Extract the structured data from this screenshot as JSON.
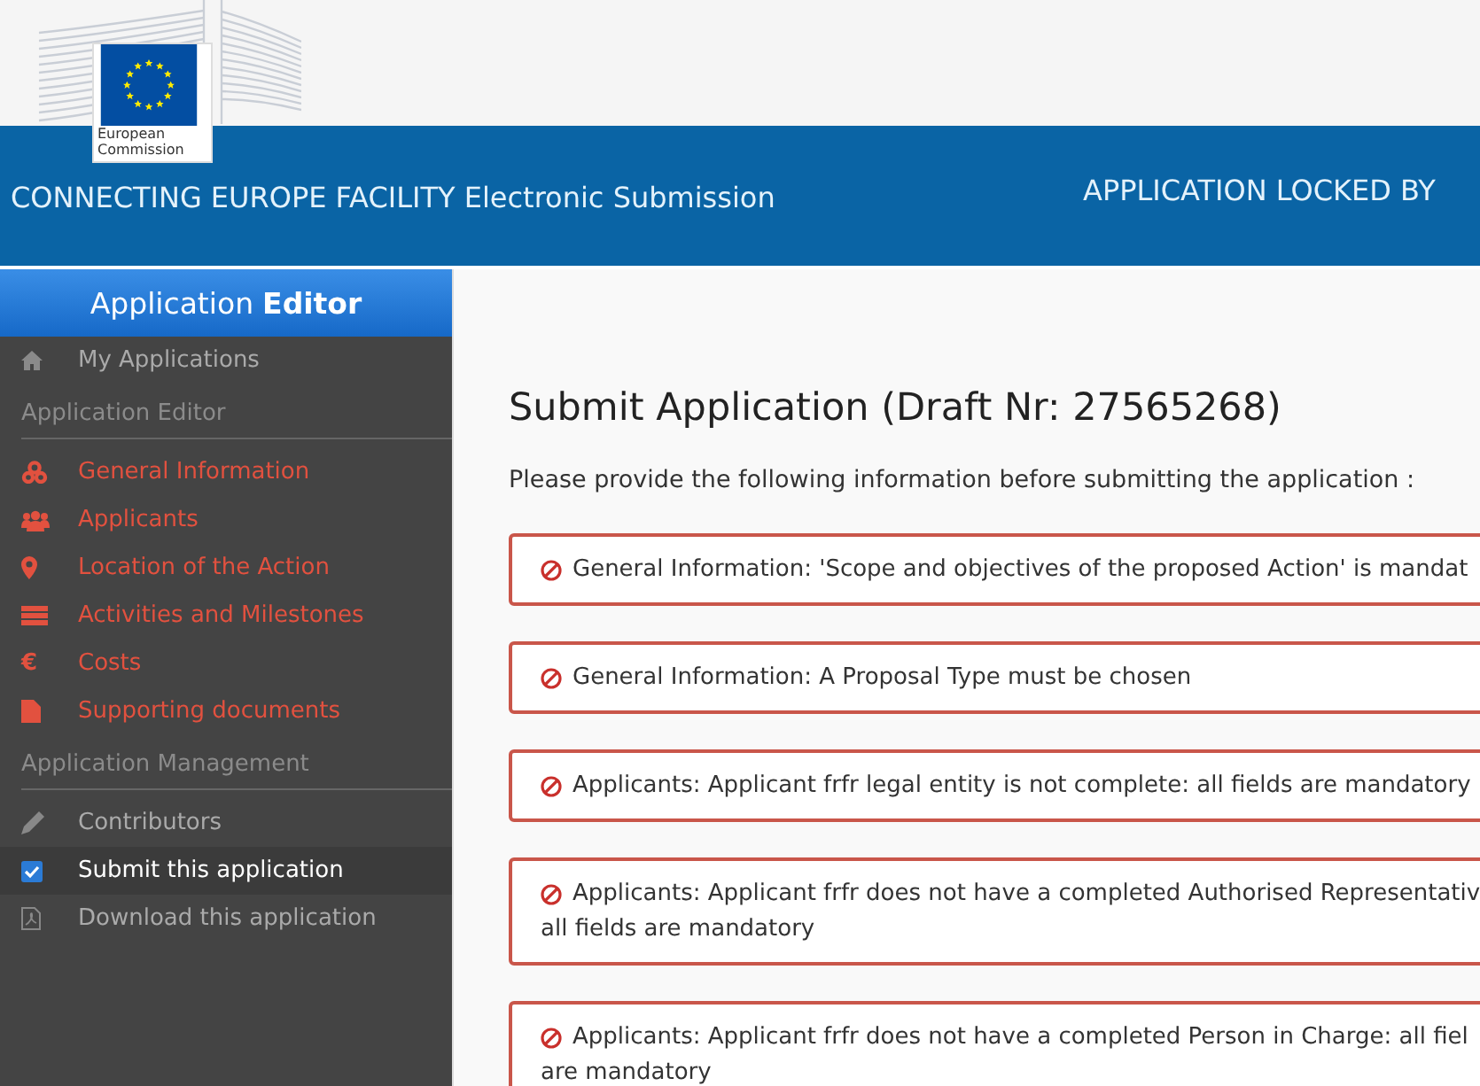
{
  "logo": {
    "line1": "European",
    "line2": "Commission"
  },
  "header": {
    "title": "CONNECTING EUROPE FACILITY Electronic Submission",
    "lock_notice": "APPLICATION LOCKED BY"
  },
  "sidebar": {
    "heading": {
      "plain": "Application",
      "bold": "Editor"
    },
    "top_item": {
      "label": "My Applications"
    },
    "sections": [
      {
        "title": "Application Editor",
        "items": [
          {
            "label": "General Information",
            "incomplete": true,
            "selected": false
          },
          {
            "label": "Applicants",
            "incomplete": true,
            "selected": false
          },
          {
            "label": "Location of the Action",
            "incomplete": true,
            "selected": false
          },
          {
            "label": "Activities and Milestones",
            "incomplete": true,
            "selected": false
          },
          {
            "label": "Costs",
            "glyph": "€",
            "incomplete": true,
            "selected": false
          },
          {
            "label": "Supporting documents",
            "incomplete": true,
            "selected": false
          }
        ]
      },
      {
        "title": "Application Management",
        "items": [
          {
            "label": "Contributors",
            "incomplete": false,
            "selected": false
          },
          {
            "label": "Submit this application",
            "incomplete": false,
            "selected": true
          },
          {
            "label": "Download this application",
            "incomplete": false,
            "selected": false
          }
        ]
      }
    ]
  },
  "main": {
    "title": "Submit Application (Draft Nr: 27565268)",
    "intro": "Please provide the following information before submitting the application :",
    "errors": [
      {
        "lines": [
          "General Information: 'Scope and objectives of the proposed Action' is mandat"
        ]
      },
      {
        "lines": [
          "General Information: A Proposal Type must be chosen"
        ]
      },
      {
        "lines": [
          "Applicants: Applicant frfr legal entity is not complete: all fields are mandatory"
        ]
      },
      {
        "lines": [
          "Applicants: Applicant frfr does not have a completed Authorised Representativ",
          "all fields are mandatory"
        ]
      },
      {
        "lines": [
          "Applicants: Applicant frfr does not have a completed Person in Charge: all fiel",
          "are mandatory"
        ]
      }
    ]
  }
}
